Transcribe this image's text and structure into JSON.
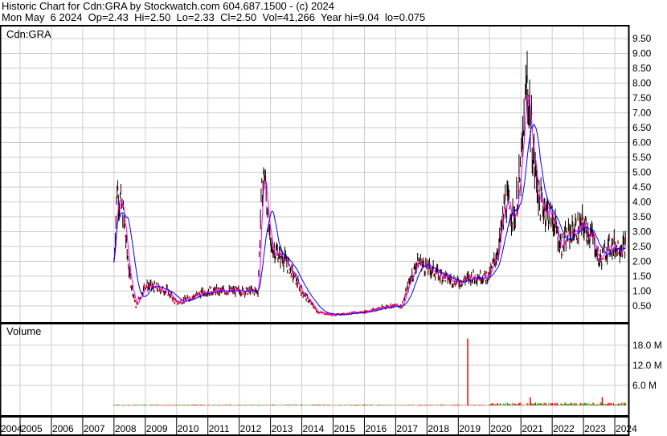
{
  "header": {
    "line1": "Historic Chart for Cdn:GRA by Stockwatch.com 604.687.1500 - (c) 2024",
    "line2": "Mon May  6 2024  Op=2.43  Hi=2.50  Lo=2.33  Cl=2.50  Vol=41,266  Year hi=9.04  lo=0.075"
  },
  "chart_data": [
    {
      "type": "line",
      "title": "Cdn:GRA",
      "ylim": [
        0,
        10
      ],
      "yticks": [
        "0.50",
        "1.00",
        "1.50",
        "2.00",
        "2.50",
        "3.00",
        "3.50",
        "4.00",
        "4.50",
        "5.00",
        "5.50",
        "6.00",
        "6.50",
        "7.00",
        "7.50",
        "8.00",
        "8.50",
        "9.00",
        "9.50"
      ],
      "xlabels": [
        "2004",
        "2005",
        "2006",
        "2007",
        "2008",
        "2009",
        "2010",
        "2011",
        "2012",
        "2013",
        "2014",
        "2015",
        "2016",
        "2017",
        "2018",
        "2019",
        "2020",
        "2021",
        "2022",
        "2023",
        "2024"
      ],
      "series": [
        {
          "name": "price",
          "color": "#000000",
          "points": [
            [
              2008.0,
              2.0
            ],
            [
              2008.1,
              4.5
            ],
            [
              2008.3,
              3.5
            ],
            [
              2008.5,
              1.5
            ],
            [
              2008.7,
              0.5
            ],
            [
              2009.0,
              1.2
            ],
            [
              2009.7,
              1.0
            ],
            [
              2010.0,
              0.6
            ],
            [
              2010.5,
              0.8
            ],
            [
              2011.0,
              1.0
            ],
            [
              2012.6,
              1.0
            ],
            [
              2012.7,
              4.0
            ],
            [
              2012.8,
              5.0
            ],
            [
              2013.0,
              2.5
            ],
            [
              2013.5,
              2.0
            ],
            [
              2014.0,
              1.0
            ],
            [
              2014.5,
              0.3
            ],
            [
              2015.0,
              0.2
            ],
            [
              2016.0,
              0.3
            ],
            [
              2016.8,
              0.5
            ],
            [
              2017.2,
              0.5
            ],
            [
              2017.5,
              1.5
            ],
            [
              2017.7,
              2.0
            ],
            [
              2018.0,
              1.8
            ],
            [
              2018.5,
              1.5
            ],
            [
              2019.0,
              1.3
            ],
            [
              2019.5,
              1.5
            ],
            [
              2020.0,
              1.5
            ],
            [
              2020.3,
              2.5
            ],
            [
              2020.5,
              4.0
            ],
            [
              2020.8,
              3.5
            ],
            [
              2021.0,
              5.0
            ],
            [
              2021.2,
              8.0
            ],
            [
              2021.4,
              5.5
            ],
            [
              2021.6,
              4.0
            ],
            [
              2022.0,
              3.5
            ],
            [
              2022.3,
              2.5
            ],
            [
              2022.6,
              3.0
            ],
            [
              2023.0,
              3.2
            ],
            [
              2023.3,
              2.8
            ],
            [
              2023.5,
              2.0
            ],
            [
              2023.8,
              2.5
            ],
            [
              2024.35,
              2.5
            ]
          ]
        },
        {
          "name": "short-ma",
          "color": "#ff00ff"
        },
        {
          "name": "long-ma",
          "color": "#0000ff"
        }
      ]
    },
    {
      "type": "bar",
      "title": "Volume",
      "ylim": [
        0,
        22
      ],
      "yticks": [
        "6.0 M",
        "12.0 M",
        "18.0 M"
      ],
      "spikes": [
        [
          2019.3,
          20
        ],
        [
          2021.3,
          2.5
        ],
        [
          2023.6,
          2.5
        ]
      ]
    }
  ]
}
